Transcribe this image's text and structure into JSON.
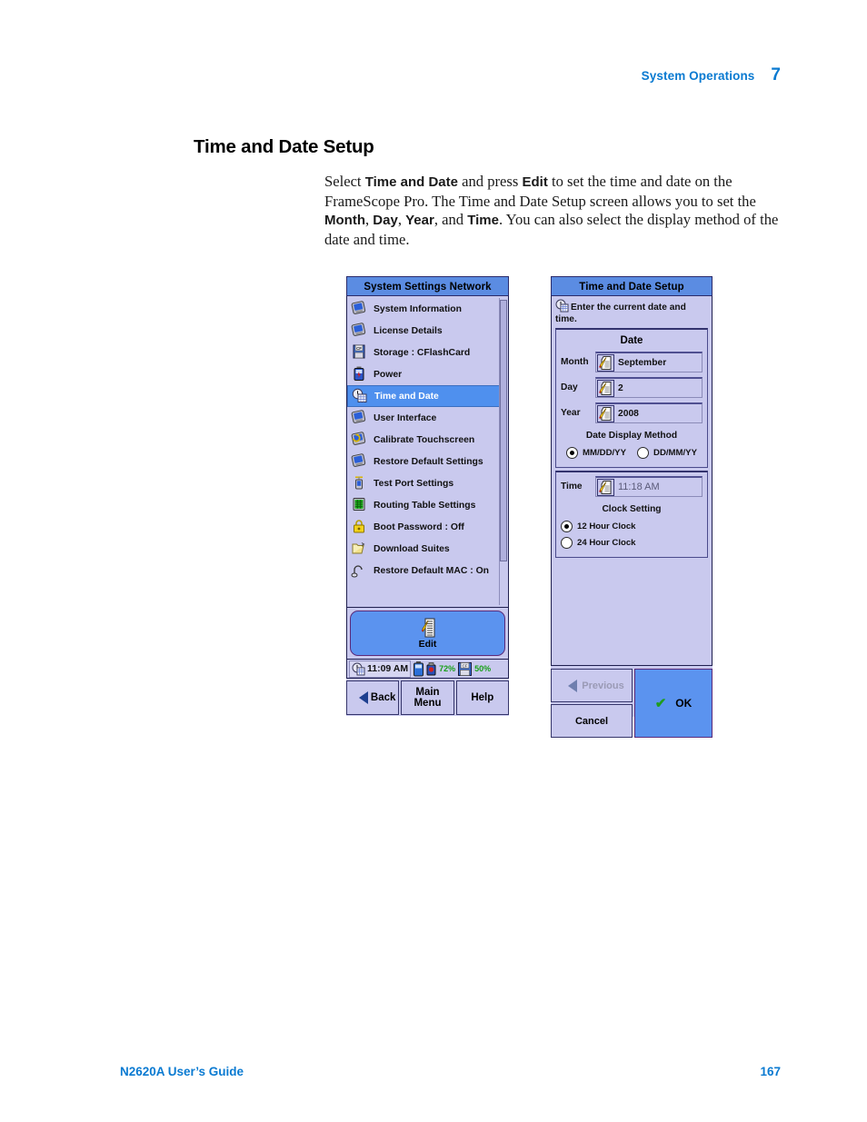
{
  "page": {
    "running_head_title": "System Operations",
    "running_head_chapter": "7",
    "section_title": "Time and Date Setup",
    "footer_left": "N2620A User’s Guide",
    "footer_right": "167",
    "accent_color": "#0a7ad1"
  },
  "body": {
    "p1_a": "Select ",
    "p1_b1": "Time and Date",
    "p1_c": " and press ",
    "p1_b2": "Edit",
    "p1_d": " to set the time and date on the FrameScope Pro. The Time and Date Setup screen allows you to set the ",
    "p1_b3": "Month",
    "p1_e": ", ",
    "p1_b4": "Day",
    "p1_f": ", ",
    "p1_b5": "Year",
    "p1_g": ", and ",
    "p1_b6": "Time",
    "p1_h": ". You can also select the display method of the date and time."
  },
  "left_device": {
    "title": "System Settings Network",
    "items": [
      {
        "label": "System Information",
        "icon": "device-icon",
        "selected": false
      },
      {
        "label": "License Details",
        "icon": "device-icon",
        "selected": false
      },
      {
        "label": "Storage : CFlashCard",
        "icon": "cf-card-icon",
        "selected": false
      },
      {
        "label": "Power",
        "icon": "battery-icon",
        "selected": false
      },
      {
        "label": "Time and Date",
        "icon": "clock-calendar-icon",
        "selected": true
      },
      {
        "label": "User Interface",
        "icon": "device-icon",
        "selected": false
      },
      {
        "label": "Calibrate Touchscreen",
        "icon": "touchscreen-icon",
        "selected": false
      },
      {
        "label": "Restore Default Settings",
        "icon": "device-icon",
        "selected": false
      },
      {
        "label": "Test Port Settings",
        "icon": "test-port-icon",
        "selected": false
      },
      {
        "label": "Routing Table Settings",
        "icon": "routing-table-icon",
        "selected": false
      },
      {
        "label": "Boot Password : Off",
        "icon": "padlock-icon",
        "selected": false
      },
      {
        "label": "Download Suites",
        "icon": "folder-icon",
        "selected": false
      },
      {
        "label": "Restore Default MAC : On",
        "icon": "connector-icon",
        "selected": false
      }
    ],
    "edit_button": {
      "label": "Edit",
      "icon": "edit-note-icon"
    },
    "statusbar": {
      "clock": "11:09 AM",
      "battery_pct": "72%",
      "storage_pct": "50%",
      "battery_icon": "battery-icon",
      "power_icon": "ac-icon",
      "storage_icon": "floppy-cf-icon"
    },
    "nav": [
      {
        "label": "Back",
        "icon": "triangle-left-icon"
      },
      {
        "label": "Main\nMenu",
        "icon": ""
      },
      {
        "label": "Help",
        "icon": ""
      }
    ],
    "nav_back": "Back",
    "nav_main_line1": "Main",
    "nav_main_line2": "Menu",
    "nav_help": "Help"
  },
  "right_device": {
    "title": "Time and Date Setup",
    "hint": "Enter the current date and time.",
    "hint_icon": "clock-calendar-icon",
    "date_group": {
      "title": "Date",
      "fields": [
        {
          "label": "Month",
          "value": "September",
          "icon": "edit-note-icon"
        },
        {
          "label": "Day",
          "value": "2",
          "icon": "edit-note-icon"
        },
        {
          "label": "Year",
          "value": "2008",
          "icon": "edit-note-icon"
        }
      ],
      "display_method_title": "Date Display Method",
      "options": [
        {
          "label": "MM/DD/YY",
          "selected": true
        },
        {
          "label": "DD/MM/YY",
          "selected": false
        }
      ]
    },
    "time_group": {
      "label": "Time",
      "value": "11:18 AM",
      "icon": "edit-note-icon",
      "clock_setting_title": "Clock Setting",
      "options": [
        {
          "label": "12 Hour Clock",
          "selected": true
        },
        {
          "label": "24 Hour Clock",
          "selected": false
        }
      ]
    },
    "buttons": {
      "previous": "Previous",
      "cancel": "Cancel",
      "ok": "OK",
      "previous_icon": "triangle-left-icon",
      "ok_icon": "check-icon"
    }
  }
}
